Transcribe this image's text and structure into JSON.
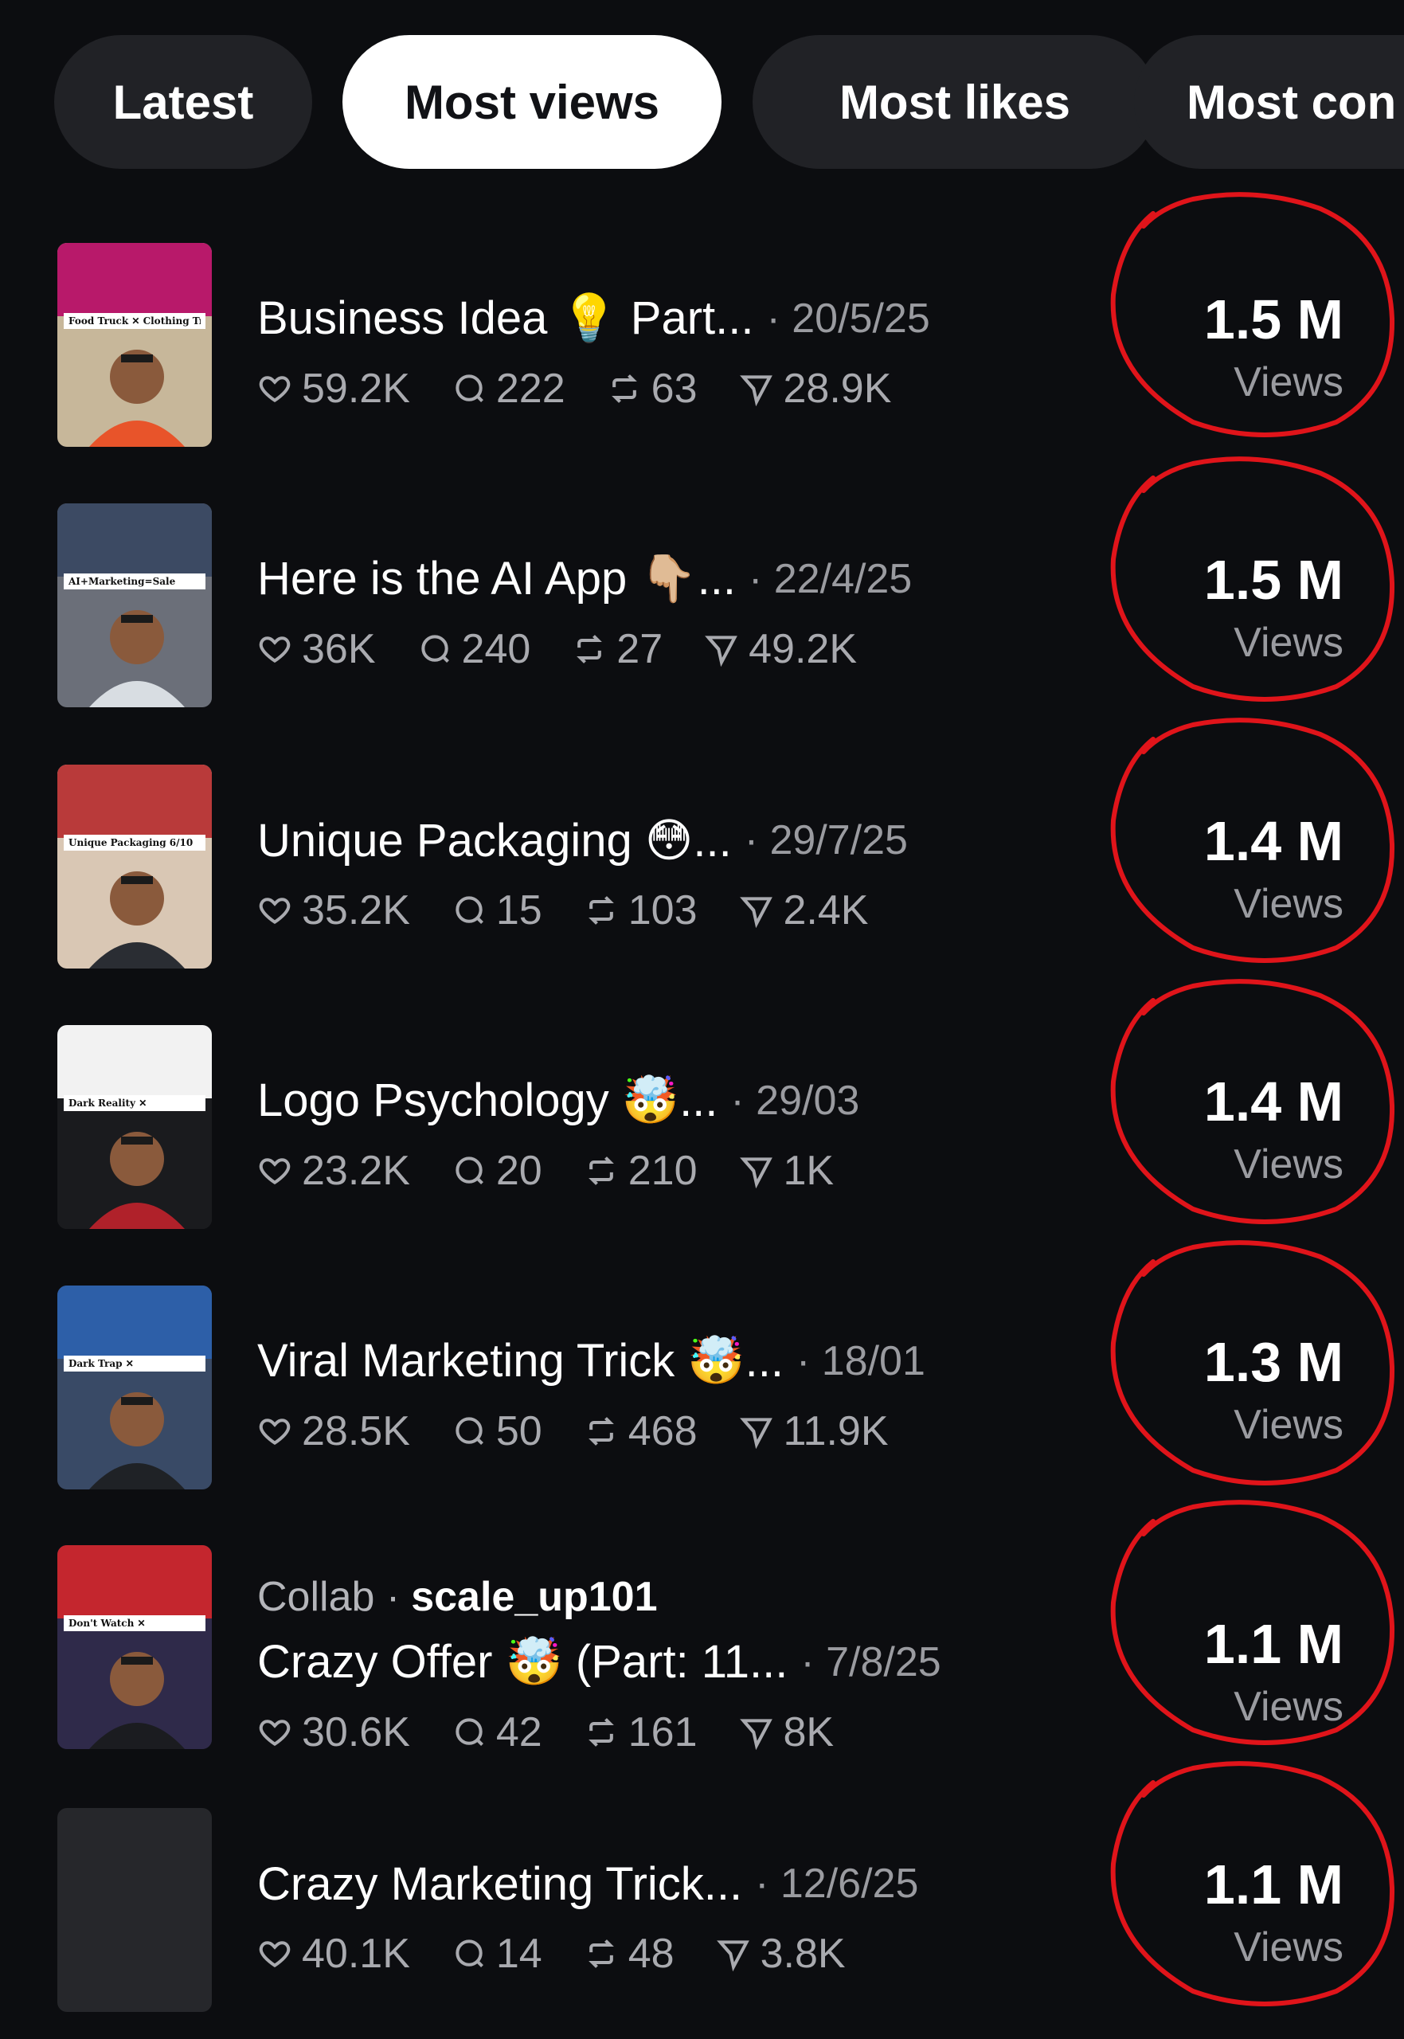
{
  "tabs": [
    {
      "label": "Latest",
      "active": false
    },
    {
      "label": "Most views",
      "active": true
    },
    {
      "label": "Most likes",
      "active": false
    },
    {
      "label": "Most con",
      "active": false
    }
  ],
  "posts": [
    {
      "title": "Business Idea 💡 Part...",
      "date": "· 20/5/25",
      "likes": "59.2K",
      "replies": "222",
      "reposts": "63",
      "shares": "28.9K",
      "views": "1.5 M",
      "views_label": "Views",
      "thumb_caption": "Food Truck ✕ Clothing Truck ✅"
    },
    {
      "title": "Here is the AI App 👇🏼...",
      "date": "· 22/4/25",
      "likes": "36K",
      "replies": "240",
      "reposts": "27",
      "shares": "49.2K",
      "views": "1.5 M",
      "views_label": "Views",
      "thumb_caption": "AI+Marketing=Sale"
    },
    {
      "title": "Unique Packaging 😳...",
      "date": "· 29/7/25",
      "likes": "35.2K",
      "replies": "15",
      "reposts": "103",
      "shares": "2.4K",
      "views": "1.4 M",
      "views_label": "Views",
      "thumb_caption": "Unique Packaging 6/10"
    },
    {
      "title": "Logo Psychology 🤯...",
      "date": "· 29/03",
      "likes": "23.2K",
      "replies": "20",
      "reposts": "210",
      "shares": "1K",
      "views": "1.4 M",
      "views_label": "Views",
      "thumb_caption": "Dark Reality ✕"
    },
    {
      "title": "Viral Marketing Trick 🤯...",
      "date": "· 18/01",
      "likes": "28.5K",
      "replies": "50",
      "reposts": "468",
      "shares": "11.9K",
      "views": "1.3 M",
      "views_label": "Views",
      "thumb_caption": "Dark Trap ✕"
    },
    {
      "collab_prefix": "Collab ·",
      "collab_user": "scale_up101",
      "title": "Crazy Offer 🤯 (Part: 11...",
      "date": "· 7/8/25",
      "likes": "30.6K",
      "replies": "42",
      "reposts": "161",
      "shares": "8K",
      "views": "1.1 M",
      "views_label": "Views",
      "thumb_caption": "Don't Watch ✕"
    },
    {
      "title": "Crazy Marketing Trick...",
      "date": "· 12/6/25",
      "likes": "40.1K",
      "replies": "14",
      "reposts": "48",
      "shares": "3.8K",
      "views": "1.1 M",
      "views_label": "Views"
    }
  ],
  "colors": {
    "background": "#0c0d10",
    "pill": "#212226",
    "active_pill": "#ffffff",
    "annotation": "#e0141a",
    "muted": "#9a9ba0"
  },
  "icons": {
    "likes": "heart-icon",
    "replies": "reply-bubble-icon",
    "reposts": "repost-icon",
    "shares": "share-icon"
  }
}
